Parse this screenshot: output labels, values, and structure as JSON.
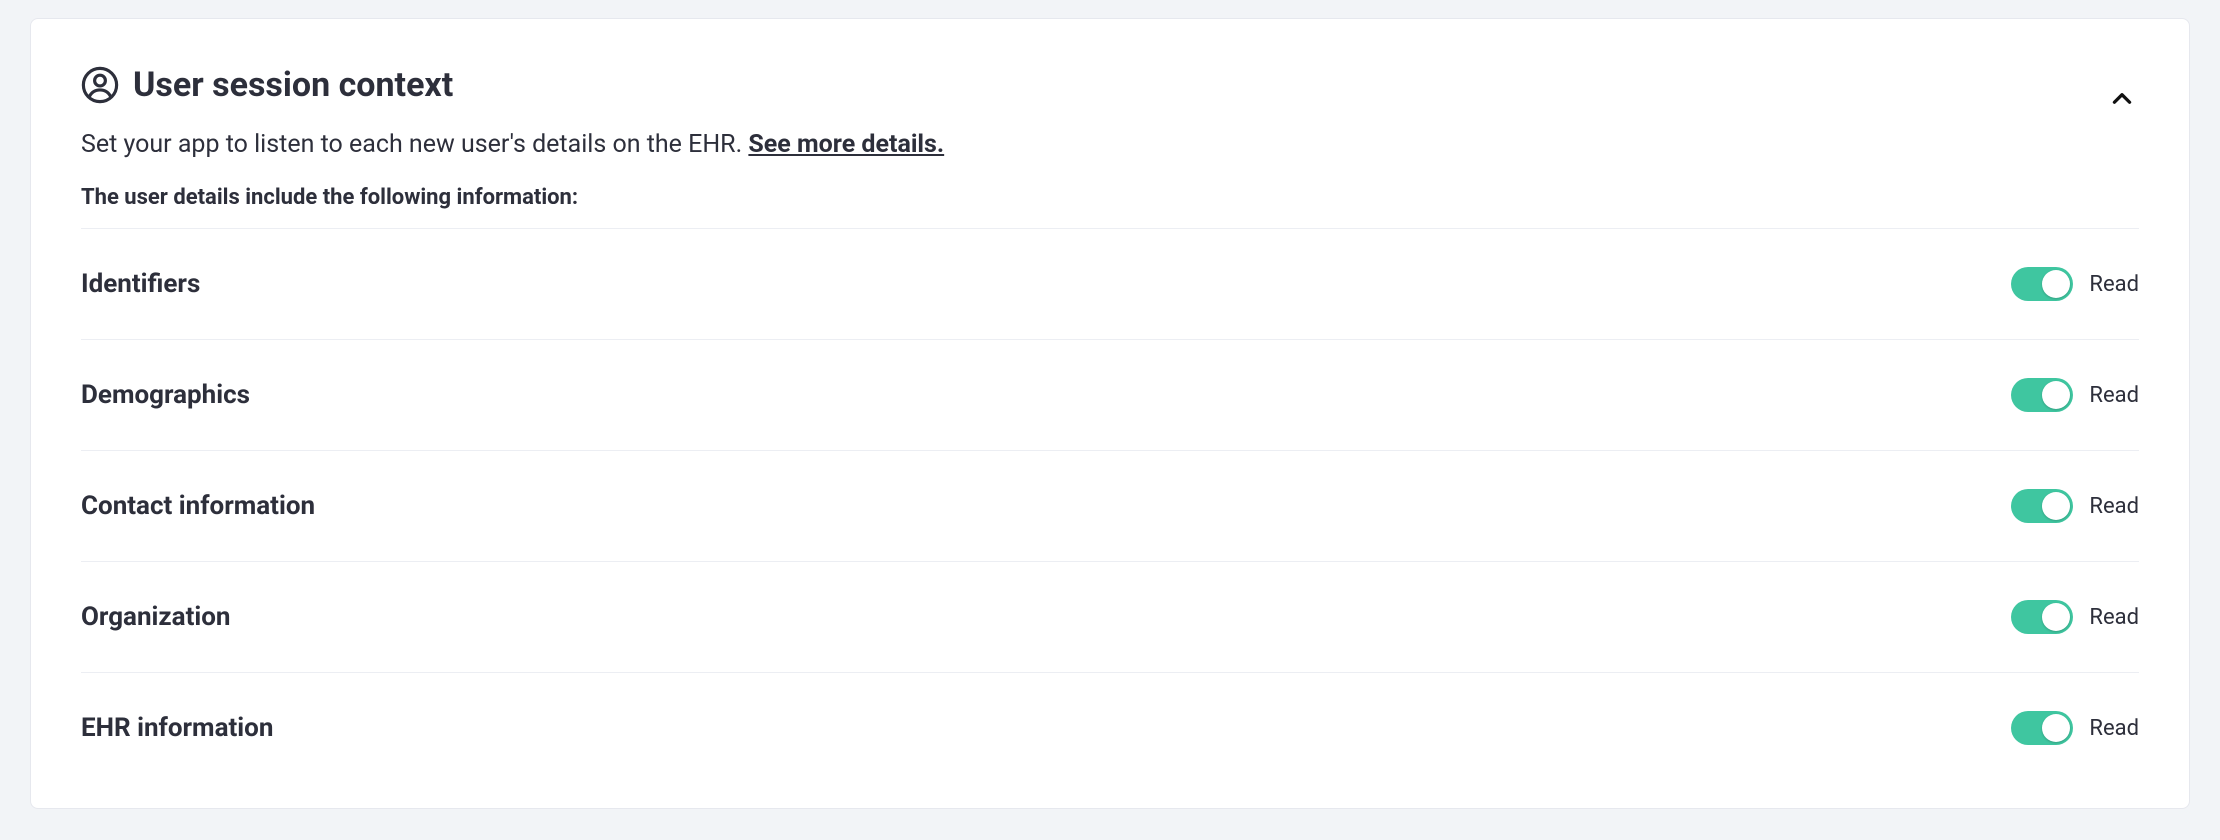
{
  "panel": {
    "title": "User session context",
    "subtitle_pre": "Set your app to listen to each new user's details on the EHR. ",
    "subtitle_link": "See more details.",
    "details_label": "The user details include the following information:"
  },
  "rows": [
    {
      "label": "Identifiers",
      "permission": "Read",
      "enabled": true
    },
    {
      "label": "Demographics",
      "permission": "Read",
      "enabled": true
    },
    {
      "label": "Contact information",
      "permission": "Read",
      "enabled": true
    },
    {
      "label": "Organization",
      "permission": "Read",
      "enabled": true
    },
    {
      "label": "EHR information",
      "permission": "Read",
      "enabled": true
    }
  ],
  "colors": {
    "toggle_on": "#3fc6a0"
  }
}
